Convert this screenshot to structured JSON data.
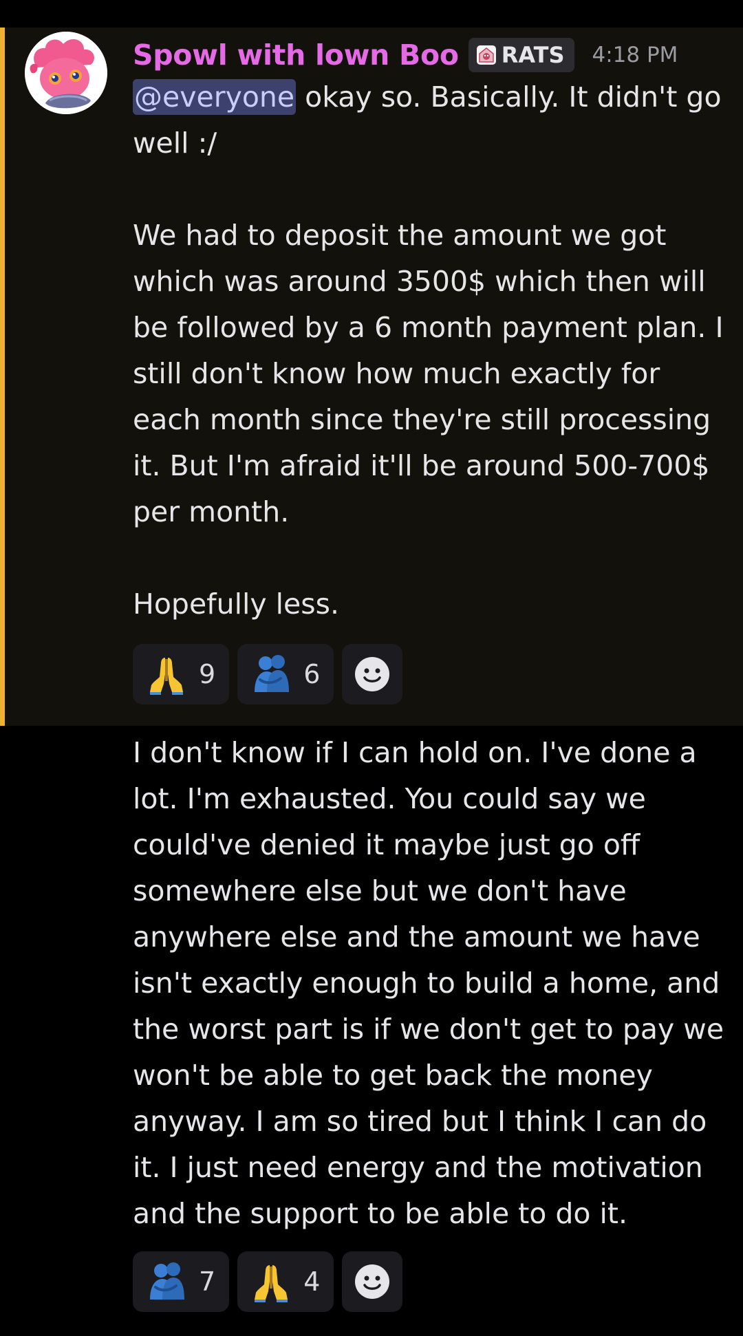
{
  "message1": {
    "author": "Spowl with lown Boo",
    "role": "RATS",
    "timestamp": "4:18 PM",
    "mention": "@everyone",
    "text_after_mention": " okay so. Basically. It didn't go\nwell :/\n\nWe had to deposit the amount we got\nwhich was around 3500$ which then will\nbe followed by a 6 month payment plan. I\nstill don't know how much exactly for\neach month since they're still processing\nit. But I'm afraid it'll be around 500-700$\nper month.\n\nHopefully less.",
    "reactions": [
      {
        "emoji": "folded-hands",
        "count": "9"
      },
      {
        "emoji": "people-hugging",
        "count": "6"
      }
    ]
  },
  "message2": {
    "text": "I don't know if I can hold on. I've done a\nlot. I'm exhausted. You could say we\ncould've denied it maybe just go off\nsomewhere else but we don't have\nanywhere else and the amount we have\nisn't exactly enough to build a home, and\nthe worst part is if we don't get to pay we\nwon't be able to get back the money\nanyway. I am so tired but I think I can do\nit. I just need energy and the motivation\nand the support to be able to do it.",
    "reactions": [
      {
        "emoji": "people-hugging",
        "count": "7"
      },
      {
        "emoji": "folded-hands",
        "count": "4"
      }
    ]
  },
  "colors": {
    "highlight_bar": "#f0b232",
    "highlight_bg": "#13110b",
    "username": "#e46ae6",
    "mention_bg": "#3c416e",
    "mention_text": "#c8cdfc"
  }
}
